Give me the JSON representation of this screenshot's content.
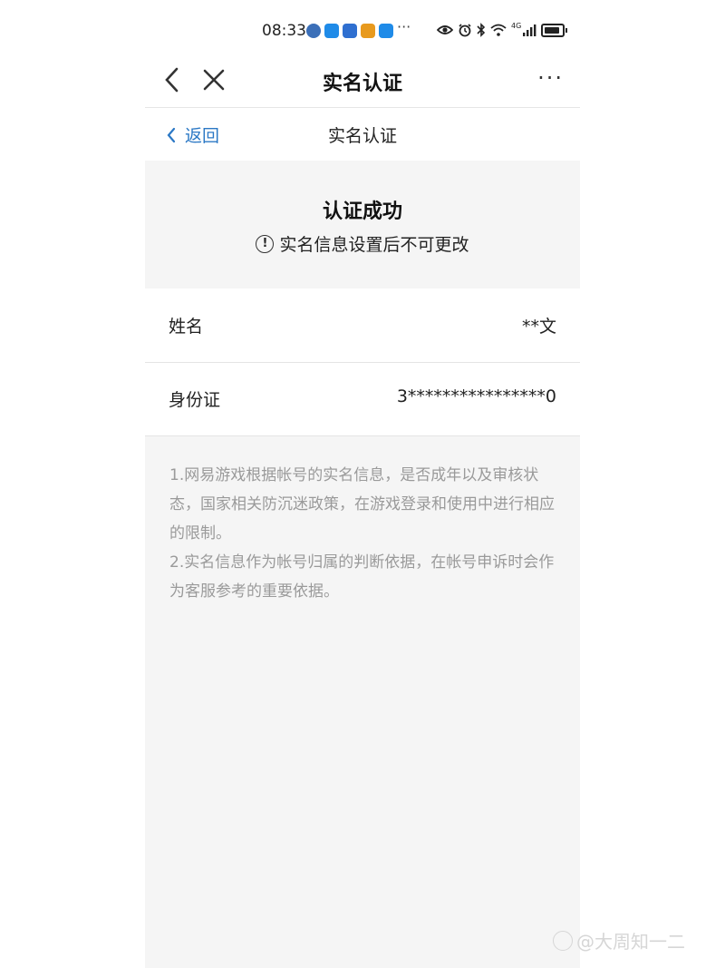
{
  "status_bar": {
    "time": "08:33",
    "apps": [
      "#3b6fb8",
      "#1f8be8",
      "#2f6fd0",
      "#e89a1e",
      "#1f8be8"
    ],
    "more": "···",
    "network_label": "4G"
  },
  "topbar": {
    "title": "实名认证",
    "more": "···"
  },
  "subheader": {
    "back_label": "返回",
    "title": "实名认证"
  },
  "success": {
    "title": "认证成功",
    "info_glyph": "!",
    "notice": "实名信息设置后不可更改"
  },
  "rows": [
    {
      "label": "姓名",
      "value": "**文"
    },
    {
      "label": "身份证",
      "value": "3****************0"
    }
  ],
  "notes": [
    "1.网易游戏根据帐号的实名信息，是否成年以及审核状态，国家相关防沉迷政策，在游戏登录和使用中进行相应的限制。",
    "2.实名信息作为帐号归属的判断依据，在帐号申诉时会作为客服参考的重要依据。"
  ],
  "watermark": "@大周知一二",
  "colors": {
    "accent": "#2b78c5",
    "panel_bg": "#f5f5f5",
    "note_text": "#9a9a9a"
  }
}
